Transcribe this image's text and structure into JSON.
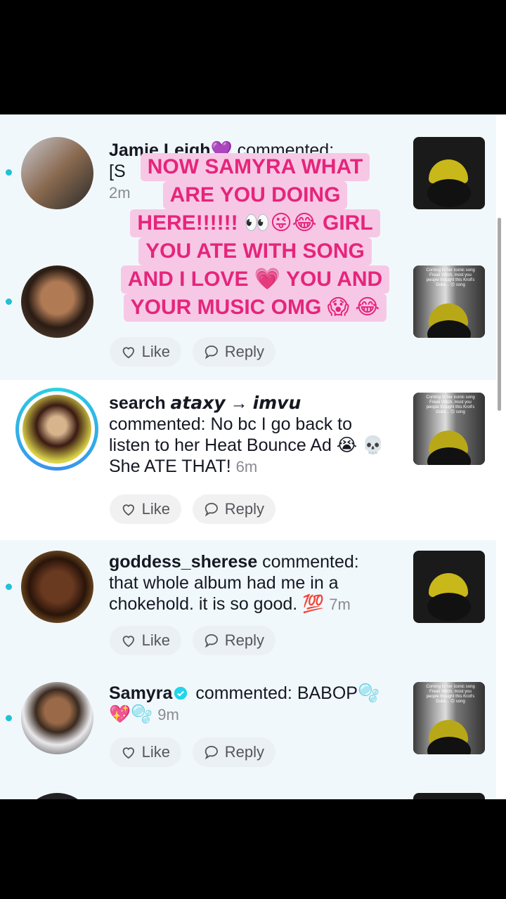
{
  "comments": [
    {
      "username": "Jamie Leigh💜",
      "verb": "commented:",
      "body_visible": "[S",
      "time": "2m",
      "unread": true
    },
    {
      "username": "",
      "verb": "",
      "body_visible": "",
      "time": "",
      "unread": true,
      "like_label": "Like",
      "reply_label": "Reply"
    },
    {
      "username": "search 𝙖𝙩𝙖𝙭𝙮 → 𝙞𝙢𝙫𝙪",
      "verb": "commented:",
      "body": "No bc I go back to listen to her Heat Bounce Ad 😭 💀 She ATE THAT!",
      "time": "6m",
      "unread": false,
      "like_label": "Like",
      "reply_label": "Reply"
    },
    {
      "username": "goddess_sherese",
      "verb": "commented:",
      "body": "that whole album had me in a chokehold. it is so good. 💯",
      "time": "7m",
      "unread": true,
      "like_label": "Like",
      "reply_label": "Reply"
    },
    {
      "username": "Samyra",
      "verb": "commented:",
      "body": "BABOP🫧 💖🫧",
      "time": "9m",
      "unread": true,
      "like_label": "Like",
      "reply_label": "Reply"
    }
  ],
  "overlay": {
    "lines": [
      "NOW SAMYRA WHAT",
      "ARE YOU DOING",
      "HERE!!!!!! 👀😜😂 GIRL",
      "YOU ATE WITH SONG",
      "AND I LOVE 💗 YOU AND",
      "YOUR MUSIC OMG 😱 😂"
    ]
  },
  "thumb_caption": "Coming to her iconic song Freak Witch, most you people thought this Kroll's Duke... 🙃 song",
  "colors": {
    "accent": "#1fc1d6",
    "overlay_bg": "#f7c8e6",
    "overlay_text": "#e5257b",
    "verified": "#20d5ec"
  }
}
